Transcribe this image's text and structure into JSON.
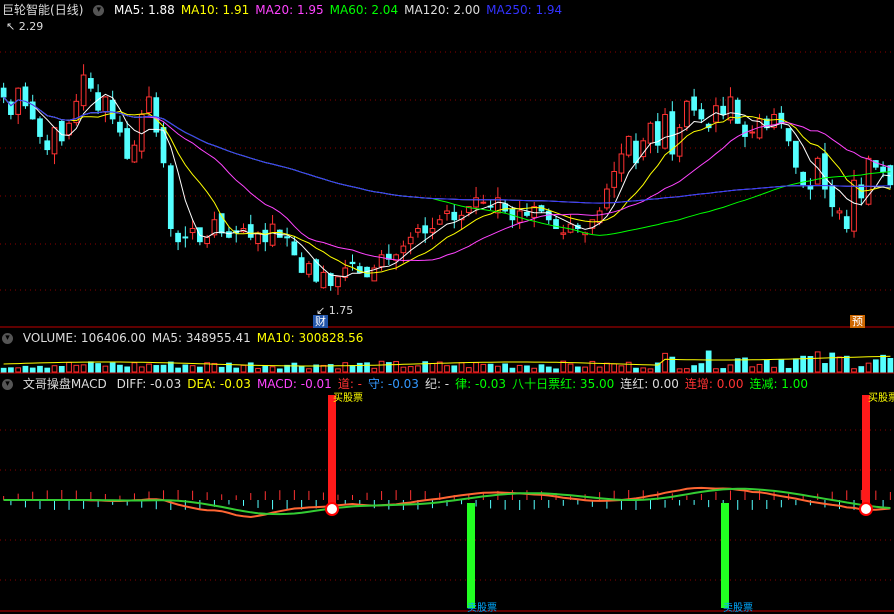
{
  "stock_name": "巨轮智能",
  "period": "(日线)",
  "ma_legend": [
    {
      "label": "MA5: 1.88",
      "color": "#ffffff"
    },
    {
      "label": "MA10: 1.91",
      "color": "#ffff00"
    },
    {
      "label": "MA20: 1.95",
      "color": "#ff44ff"
    },
    {
      "label": "MA60: 2.04",
      "color": "#00ff00"
    },
    {
      "label": "MA120: 2.00",
      "color": "#dddddd"
    },
    {
      "label": "MA250: 1.94",
      "color": "#3333ff"
    }
  ],
  "volume_legend": [
    {
      "label": "VOLUME: 106406.00",
      "color": "#dddddd"
    },
    {
      "label": "MA5: 348955.41",
      "color": "#dddddd"
    },
    {
      "label": "MA10: 300828.56",
      "color": "#ffff00"
    }
  ],
  "indicator_title": "文哥操盘MACD",
  "macd_legend": [
    {
      "label": "DIFF: -0.03",
      "color": "#dddddd"
    },
    {
      "label": "DEA: -0.03",
      "color": "#ffff00"
    },
    {
      "label": "MACD: -0.01",
      "color": "#ff44ff"
    },
    {
      "label": "道: -",
      "color": "#ff3333"
    },
    {
      "label": "守: -0.03",
      "color": "#3399ff"
    },
    {
      "label": "纪: -",
      "color": "#dddddd"
    },
    {
      "label": "律: -0.03",
      "color": "#00ff00"
    },
    {
      "label": "八十日票红: 35.00",
      "color": "#00ff00"
    },
    {
      "label": "连红: 0.00",
      "color": "#dddddd"
    },
    {
      "label": "连增: 0.00",
      "color": "#ff3333"
    },
    {
      "label": "连减: 1.00",
      "color": "#00ff00"
    }
  ],
  "price_marks": {
    "high": "2.29",
    "low": "1.75"
  },
  "badges": {
    "fin": "财",
    "pre": "预"
  },
  "signals": {
    "buy_label": "买股票",
    "sell_label": "卖股票"
  },
  "colors": {
    "up": "#ff3232",
    "down": "#54ffff",
    "grid": "#8b0000",
    "frame": "#c00000"
  },
  "chart_data": {
    "type": "candlestick",
    "price_range": [
      1.66,
      2.36
    ],
    "closes": [
      2.18,
      2.14,
      2.2,
      2.16,
      2.13,
      2.09,
      2.06,
      2.11,
      2.08,
      2.12,
      2.17,
      2.23,
      2.2,
      2.15,
      2.18,
      2.13,
      2.1,
      2.04,
      2.07,
      2.14,
      2.18,
      2.1,
      2.03,
      1.88,
      1.85,
      1.86,
      1.88,
      1.85,
      1.86,
      1.9,
      1.87,
      1.86,
      1.87,
      1.88,
      1.86,
      1.87,
      1.85,
      1.89,
      1.86,
      1.86,
      1.82,
      1.78,
      1.8,
      1.76,
      1.78,
      1.75,
      1.77,
      1.79,
      1.8,
      1.78,
      1.77,
      1.79,
      1.82,
      1.81,
      1.82,
      1.84,
      1.86,
      1.88,
      1.87,
      1.88,
      1.9,
      1.92,
      1.9,
      1.91,
      1.93,
      1.95,
      1.94,
      1.93,
      1.95,
      1.92,
      1.9,
      1.92,
      1.91,
      1.93,
      1.92,
      1.9,
      1.88,
      1.87,
      1.89,
      1.88,
      1.87,
      1.9,
      1.92,
      1.97,
      2.01,
      2.05,
      2.09,
      2.03,
      2.08,
      2.12,
      2.07,
      2.14,
      2.05,
      2.11,
      2.17,
      2.15,
      2.13,
      2.11,
      2.16,
      2.14,
      2.18,
      2.12,
      2.09,
      2.1,
      2.13,
      2.11,
      2.14,
      2.12,
      2.08,
      2.02,
      1.98,
      1.97,
      2.04,
      1.97,
      1.93,
      1.92,
      1.88,
      1.99,
      1.95,
      2.04,
      2.02,
      2.01,
      1.98
    ],
    "ma_series": [
      "MA5",
      "MA10",
      "MA20",
      "MA60",
      "MA120",
      "MA250"
    ],
    "volume_ma": {
      "MA5": 348955.41,
      "MA10": 300828.56
    },
    "macd": {
      "DIFF": -0.03,
      "DEA": -0.03,
      "MACD": -0.01
    }
  }
}
